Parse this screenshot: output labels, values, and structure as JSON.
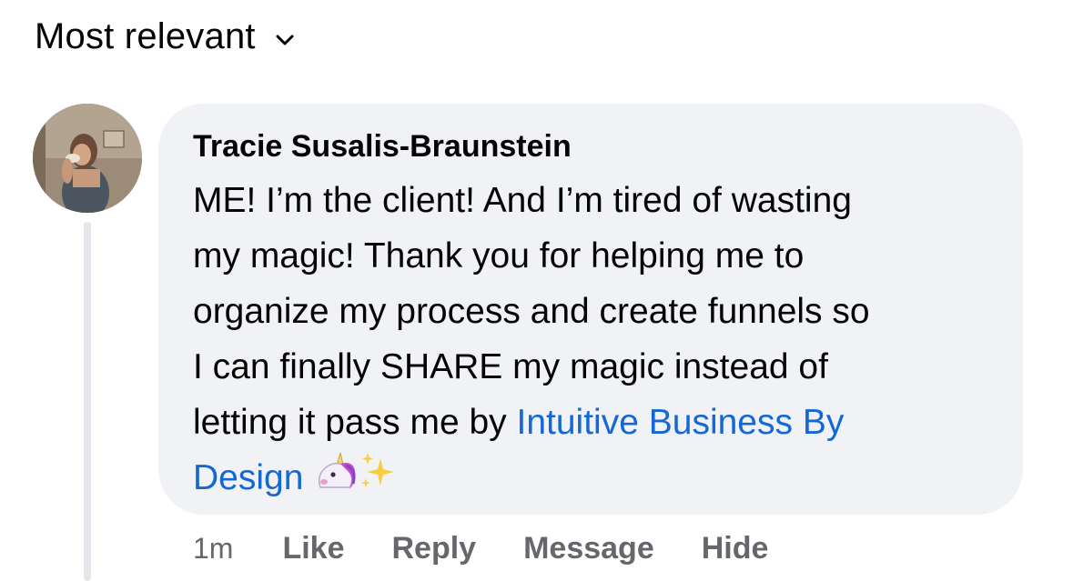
{
  "sort": {
    "label": "Most relevant",
    "icon": "chevron-down-icon"
  },
  "comment": {
    "author": "Tracie Susalis-Braunstein",
    "lines": [
      "ME! I’m the client! And I’m tired of wasting",
      "my magic! Thank you for helping me to",
      "organize my process and create funnels so",
      "I can finally SHARE my magic instead of",
      "letting it pass me by "
    ],
    "mention_part1": "Intuitive Business By",
    "mention_part2": "Design",
    "emojis": [
      "unicorn-emoji",
      "sparkles-emoji"
    ],
    "timestamp": "1m",
    "actions": {
      "like": "Like",
      "reply": "Reply",
      "message": "Message",
      "hide": "Hide"
    }
  },
  "colors": {
    "bubble_bg": "#f0f2f5",
    "mention": "#1467d6",
    "secondary_text": "#65676b",
    "thread_line": "#e4e6eb"
  }
}
